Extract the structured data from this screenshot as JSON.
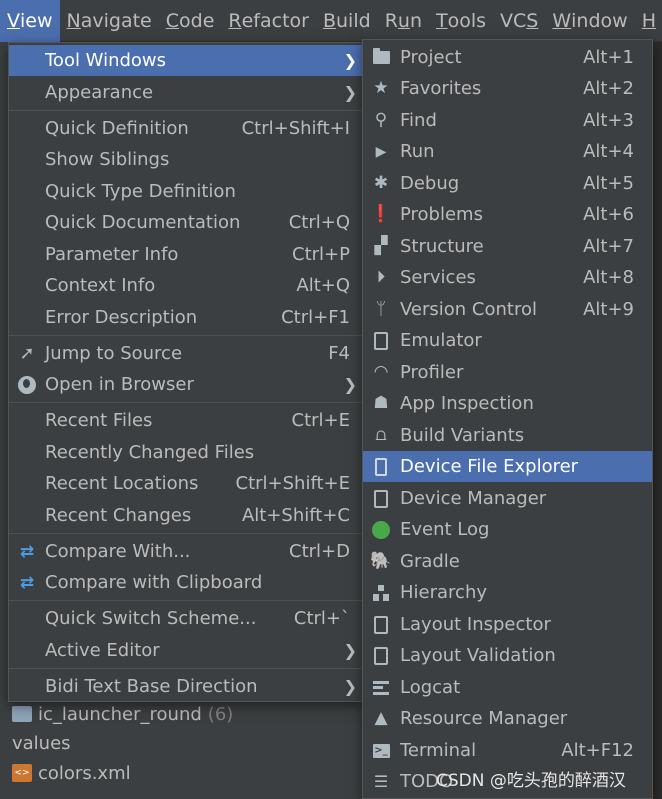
{
  "menubar": {
    "items": [
      "View",
      "Navigate",
      "Code",
      "Refactor",
      "Build",
      "Run",
      "Tools",
      "VCS",
      "Window",
      "H"
    ],
    "active": "View"
  },
  "view_menu": {
    "items": [
      {
        "label": "Tool Windows",
        "submenu": true,
        "selected": true
      },
      {
        "label": "Appearance",
        "submenu": true
      },
      {
        "label": "Quick Definition",
        "shortcut": "Ctrl+Shift+I"
      },
      {
        "label": "Show Siblings"
      },
      {
        "label": "Quick Type Definition"
      },
      {
        "label": "Quick Documentation",
        "shortcut": "Ctrl+Q"
      },
      {
        "label": "Parameter Info",
        "shortcut": "Ctrl+P"
      },
      {
        "label": "Context Info",
        "shortcut": "Alt+Q"
      },
      {
        "label": "Error Description",
        "shortcut": "Ctrl+F1"
      },
      {
        "label": "Jump to Source",
        "shortcut": "F4",
        "icon": "jump-to-source-icon"
      },
      {
        "label": "Open in Browser",
        "submenu": true,
        "icon": "globe-icon"
      },
      {
        "label": "Recent Files",
        "shortcut": "Ctrl+E"
      },
      {
        "label": "Recently Changed Files"
      },
      {
        "label": "Recent Locations",
        "shortcut": "Ctrl+Shift+E"
      },
      {
        "label": "Recent Changes",
        "shortcut": "Alt+Shift+C"
      },
      {
        "label": "Compare With...",
        "shortcut": "Ctrl+D",
        "icon": "compare-icon"
      },
      {
        "label": "Compare with Clipboard",
        "icon": "compare-clipboard-icon"
      },
      {
        "label": "Quick Switch Scheme...",
        "shortcut": "Ctrl+`"
      },
      {
        "label": "Active Editor",
        "submenu": true
      },
      {
        "label": "Bidi Text Base Direction",
        "submenu": true
      }
    ]
  },
  "tool_windows_menu": {
    "items": [
      {
        "label": "Project",
        "shortcut": "Alt+1",
        "icon": "folder-icon"
      },
      {
        "label": "Favorites",
        "shortcut": "Alt+2",
        "icon": "star-icon"
      },
      {
        "label": "Find",
        "shortcut": "Alt+3",
        "icon": "search-icon"
      },
      {
        "label": "Run",
        "shortcut": "Alt+4",
        "icon": "play-icon"
      },
      {
        "label": "Debug",
        "shortcut": "Alt+5",
        "icon": "bug-icon"
      },
      {
        "label": "Problems",
        "shortcut": "Alt+6",
        "icon": "problems-icon"
      },
      {
        "label": "Structure",
        "shortcut": "Alt+7",
        "icon": "structure-icon"
      },
      {
        "label": "Services",
        "shortcut": "Alt+8",
        "icon": "services-icon"
      },
      {
        "label": "Version Control",
        "shortcut": "Alt+9",
        "icon": "version-control-icon"
      },
      {
        "label": "Emulator",
        "icon": "emulator-icon"
      },
      {
        "label": "Profiler",
        "icon": "gauge-icon"
      },
      {
        "label": "App Inspection",
        "icon": "app-inspection-icon"
      },
      {
        "label": "Build Variants",
        "icon": "android-icon"
      },
      {
        "label": "Device File Explorer",
        "icon": "phone-icon",
        "selected": true
      },
      {
        "label": "Device Manager",
        "icon": "device-manager-icon"
      },
      {
        "label": "Event Log",
        "icon": "event-log-icon"
      },
      {
        "label": "Gradle",
        "icon": "gradle-icon"
      },
      {
        "label": "Hierarchy",
        "icon": "hierarchy-icon"
      },
      {
        "label": "Layout Inspector",
        "icon": "layout-inspector-icon"
      },
      {
        "label": "Layout Validation",
        "icon": "layout-validation-icon"
      },
      {
        "label": "Logcat",
        "icon": "logcat-icon"
      },
      {
        "label": "Resource Manager",
        "icon": "resource-manager-icon"
      },
      {
        "label": "Terminal",
        "shortcut": "Alt+F12",
        "icon": "terminal-icon"
      },
      {
        "label": "TODO",
        "icon": "todo-icon"
      }
    ]
  },
  "project_tree": {
    "rows": [
      {
        "label": "ic_launcher_round",
        "count": "(6)"
      },
      {
        "label": "values"
      },
      {
        "label": "colors.xml"
      }
    ]
  },
  "watermark": "CSDN @吃头孢的醉酒汉"
}
